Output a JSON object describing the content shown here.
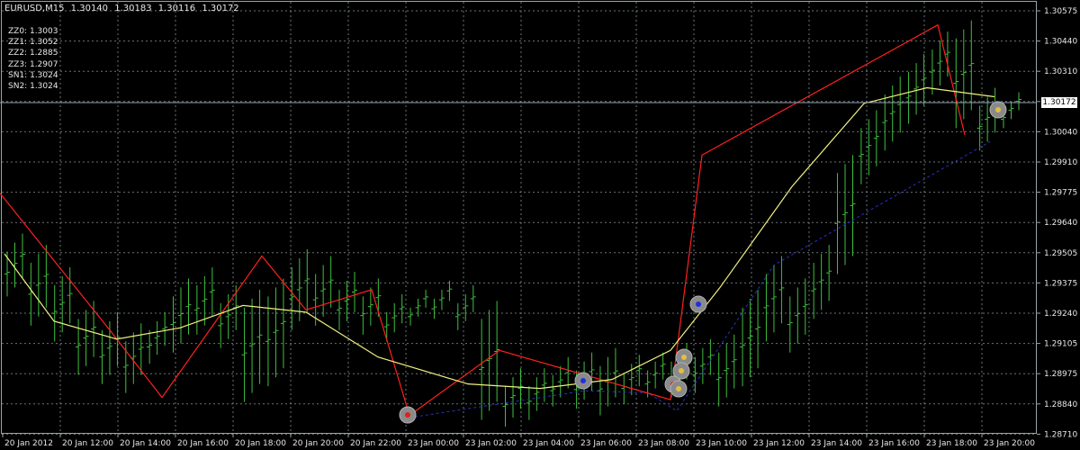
{
  "window": {
    "symbol": "EURUSD,M15",
    "ohlc": [
      "1.30140",
      "1.30183",
      "1.30116",
      "1.30172"
    ]
  },
  "indicators": [
    {
      "label": "ZZ0:",
      "value": "1.3003"
    },
    {
      "label": "ZZ1:",
      "value": "1.3052"
    },
    {
      "label": "ZZ2:",
      "value": "1.2885"
    },
    {
      "label": "ZZ3:",
      "value": "1.2907"
    },
    {
      "label": "SN1:",
      "value": "1.3024"
    },
    {
      "label": "SN2:",
      "value": "1.3024"
    }
  ],
  "current_price": "1.30172",
  "colors": {
    "background": "#000000",
    "grid": "#9aa4aa",
    "bars": "#3fbf3f",
    "zigzag": "#ff2020",
    "moving_average": "#f0f080",
    "trendline": "#3030c0",
    "text": "#e8e8e8"
  },
  "chart_data": {
    "type": "ohlc-bars",
    "timeframe": "M15",
    "y_ticks": [
      "1.30575",
      "1.30440",
      "1.30310",
      "1.30172",
      "1.30040",
      "1.29910",
      "1.29775",
      "1.29640",
      "1.29505",
      "1.29375",
      "1.29240",
      "1.29105",
      "1.28975",
      "1.28840",
      "1.28710"
    ],
    "x_ticks": [
      "20 Jan 2012",
      "20 Jan 12:00",
      "20 Jan 14:00",
      "20 Jan 16:00",
      "20 Jan 18:00",
      "20 Jan 20:00",
      "20 Jan 22:00",
      "23 Jan 00:00",
      "23 Jan 02:00",
      "23 Jan 04:00",
      "23 Jan 06:00",
      "23 Jan 08:00",
      "23 Jan 10:00",
      "23 Jan 12:00",
      "23 Jan 14:00",
      "23 Jan 16:00",
      "23 Jan 18:00",
      "23 Jan 20:00"
    ],
    "ylim": [
      1.2871,
      1.30575
    ],
    "zigzag_points": [
      1.2977,
      1.2916,
      1.2886,
      1.2949,
      1.2925,
      1.2934,
      1.2878,
      1.2907,
      1.2885,
      1.2994,
      1.3052,
      1.3003
    ],
    "ma_points": [
      1.295,
      1.292,
      1.2912,
      1.2917,
      1.2927,
      1.2924,
      1.2904,
      1.2892,
      1.289,
      1.2894,
      1.2907,
      1.2935,
      1.298,
      1.3017,
      1.3024,
      1.302
    ],
    "trendline_points": [
      1.2877,
      1.2889,
      1.2888,
      1.288,
      1.2945,
      1.3
    ],
    "bars": [
      [
        1.2955,
        1.2935
      ],
      [
        1.295,
        1.2922
      ],
      [
        1.294,
        1.2915
      ],
      [
        1.2925,
        1.29
      ],
      [
        1.292,
        1.2896
      ],
      [
        1.2915,
        1.2892
      ],
      [
        1.292,
        1.2905
      ],
      [
        1.2935,
        1.291
      ],
      [
        1.294,
        1.2918
      ],
      [
        1.2932,
        1.2912
      ],
      [
        1.293,
        1.2888
      ],
      [
        1.2935,
        1.2895
      ],
      [
        1.2948,
        1.292
      ],
      [
        1.2945,
        1.2922
      ],
      [
        1.2938,
        1.292
      ],
      [
        1.2935,
        1.2918
      ],
      [
        1.2928,
        1.2915
      ],
      [
        1.293,
        1.2922
      ],
      [
        1.2934,
        1.2925
      ],
      [
        1.2932,
        1.292
      ],
      [
        1.2925,
        1.288
      ],
      [
        1.2895,
        1.2877
      ],
      [
        1.2895,
        1.288
      ],
      [
        1.29,
        1.2886
      ],
      [
        1.2902,
        1.2885
      ],
      [
        1.2904,
        1.2882
      ],
      [
        1.2901,
        1.2887
      ],
      [
        1.2902,
        1.289
      ],
      [
        1.2906,
        1.289
      ],
      [
        1.2908,
        1.2892
      ],
      [
        1.291,
        1.2886
      ],
      [
        1.293,
        1.2895
      ],
      [
        1.2945,
        1.2915
      ],
      [
        1.2935,
        1.291
      ],
      [
        1.295,
        1.2925
      ],
      [
        1.299,
        1.2945
      ],
      [
        1.301,
        1.2985
      ],
      [
        1.3025,
        1.3
      ],
      [
        1.3035,
        1.3012
      ],
      [
        1.3045,
        1.3025
      ],
      [
        1.305,
        1.301
      ],
      [
        1.302,
        1.3
      ],
      [
        1.3018,
        1.301
      ]
    ]
  }
}
